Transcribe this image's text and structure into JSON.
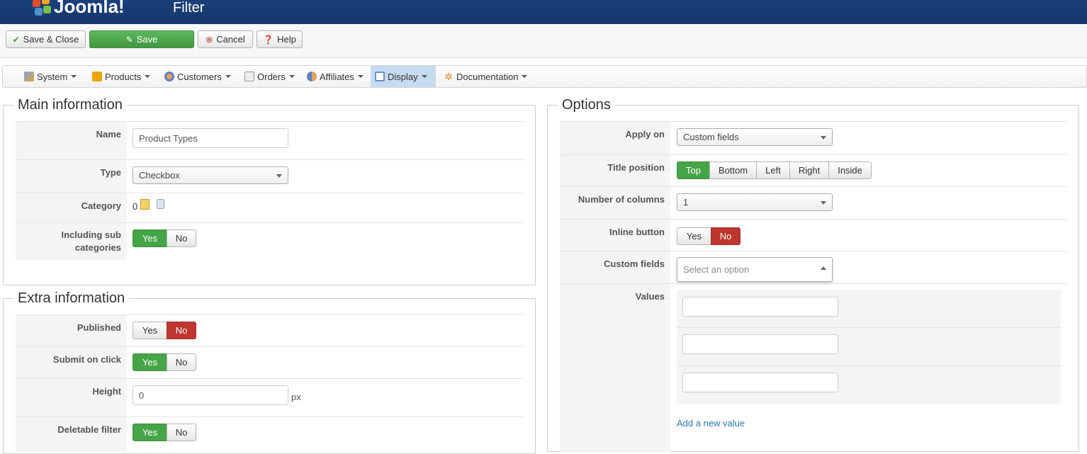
{
  "header": {
    "logo_text": "Joomla!",
    "page_title": "Filter"
  },
  "toolbar": {
    "save_close": "Save & Close",
    "save": "Save",
    "cancel": "Cancel",
    "help": "Help"
  },
  "menu": {
    "items": [
      {
        "label": "System",
        "icon": "tools-icon"
      },
      {
        "label": "Products",
        "icon": "products-icon"
      },
      {
        "label": "Customers",
        "icon": "customers-icon"
      },
      {
        "label": "Orders",
        "icon": "orders-icon"
      },
      {
        "label": "Affiliates",
        "icon": "affiliates-icon"
      },
      {
        "label": "Display",
        "icon": "display-icon",
        "active": true
      },
      {
        "label": "Documentation",
        "icon": "documentation-icon"
      }
    ]
  },
  "main": {
    "legend": "Main information",
    "name_label": "Name",
    "name_value": "Product Types",
    "type_label": "Type",
    "type_value": "Checkbox",
    "category_label": "Category",
    "category_value": "0",
    "including_sub_label": "Including sub categories",
    "yes": "Yes",
    "no": "No"
  },
  "extra": {
    "legend": "Extra information",
    "published_label": "Published",
    "submit_on_click_label": "Submit on click",
    "height_label": "Height",
    "height_value": "0",
    "height_unit": "px",
    "deletable_label": "Deletable filter",
    "yes": "Yes",
    "no": "No"
  },
  "options": {
    "legend": "Options",
    "apply_on_label": "Apply on",
    "apply_on_value": "Custom fields",
    "title_position_label": "Title position",
    "title_positions": [
      "Top",
      "Bottom",
      "Left",
      "Right",
      "Inside"
    ],
    "title_position_selected": "Top",
    "num_columns_label": "Number of columns",
    "num_columns_value": "1",
    "inline_button_label": "Inline button",
    "custom_fields_label": "Custom fields",
    "custom_fields_placeholder": "Select an option",
    "values_label": "Values",
    "add_value_link": "Add a new value",
    "yes": "Yes",
    "no": "No"
  },
  "colors": {
    "header_bg": "#1a3f7a",
    "green": "#46a546",
    "red": "#bd362f",
    "link": "#2a7ab0"
  }
}
